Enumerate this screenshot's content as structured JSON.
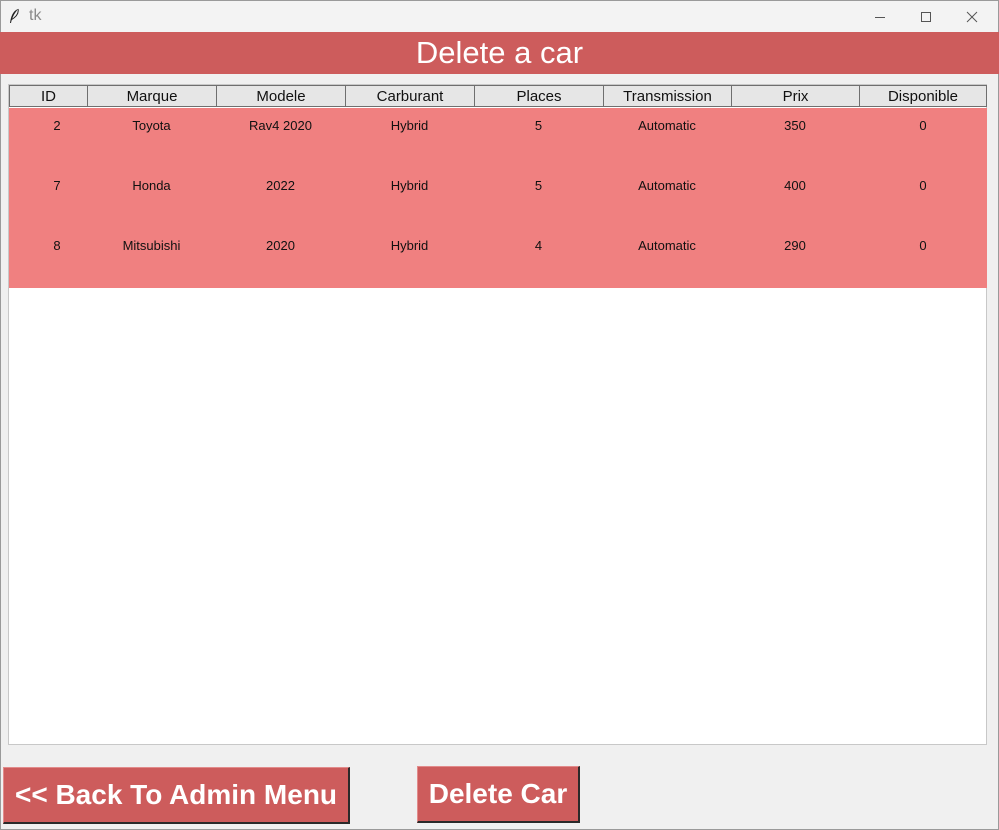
{
  "window": {
    "title": "tk"
  },
  "header": {
    "title": "Delete a car"
  },
  "table": {
    "columns": [
      "ID",
      "Marque",
      "Modele",
      "Carburant",
      "Places",
      "Transmission",
      "Prix",
      "Disponible"
    ],
    "rows": [
      [
        "2",
        "Toyota",
        "Rav4 2020",
        "Hybrid",
        "5",
        "Automatic",
        "350",
        "0"
      ],
      [
        "7",
        "Honda",
        "2022",
        "Hybrid",
        "5",
        "Automatic",
        "400",
        "0"
      ],
      [
        "8",
        "Mitsubishi",
        "2020",
        "Hybrid",
        "4",
        "Automatic",
        "290",
        "0"
      ]
    ]
  },
  "buttons": {
    "back_label": "<< Back To Admin Menu",
    "delete_label": "Delete Car"
  },
  "colors": {
    "accent": "#cd5c5c",
    "row_highlight": "#f08080"
  }
}
